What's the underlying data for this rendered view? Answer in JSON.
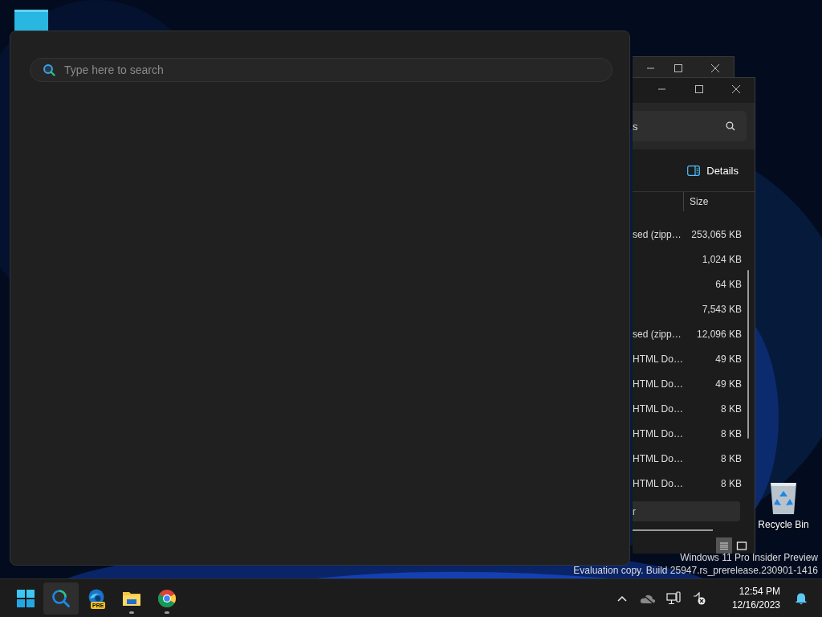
{
  "desktop_icons": [
    {
      "kind": "app"
    },
    {
      "kind": "recycle_bin",
      "label": "Recycle Bin"
    }
  ],
  "explorer_back_window": {
    "controls": [
      {
        "kind": "minimize"
      },
      {
        "kind": "maximize"
      },
      {
        "kind": "close"
      }
    ]
  },
  "explorer_window": {
    "controls": [
      {
        "kind": "minimize"
      },
      {
        "kind": "maximize"
      },
      {
        "kind": "close"
      }
    ],
    "search": {
      "value": "s"
    },
    "toolbar": {
      "details_label": "Details"
    },
    "size_header": "Size",
    "rows": [
      {
        "column_1": "sed (zipp…",
        "size": "253,065 KB"
      },
      {
        "size": "1,024 KB"
      },
      {
        "size": "64 KB"
      },
      {
        "size": "7,543 KB"
      },
      {
        "column_1": "sed (zipp…",
        "size": "12,096 KB"
      },
      {
        "column_1": "HTML Do…",
        "size": "49 KB"
      },
      {
        "column_1": "HTML Do…",
        "size": "49 KB"
      },
      {
        "column_1": "HTML Do…",
        "size": "8 KB"
      },
      {
        "column_1": "HTML Do…",
        "size": "8 KB"
      },
      {
        "column_1": "HTML Do…",
        "size": "8 KB"
      },
      {
        "column_1": "HTML Do…",
        "size": "8 KB"
      }
    ],
    "highlighted_item": {
      "text": "r"
    },
    "view_buttons": [
      {
        "kind": "details",
        "selected": true
      },
      {
        "kind": "tiles",
        "selected": false
      }
    ]
  },
  "search_panel": {
    "search": {
      "placeholder": "Type here to search"
    }
  },
  "system_notice": [
    "Windows 11 Pro Insider Preview",
    "Evaluation copy. Build 25947.rs_prerelease.230901-1416"
  ],
  "taskbar": {
    "apps": [
      {
        "kind": "start",
        "selected": false,
        "running": false
      },
      {
        "kind": "search",
        "selected": true,
        "running": false
      },
      {
        "kind": "edge",
        "badge": "PRE",
        "selected": false,
        "running": false
      },
      {
        "kind": "explorer",
        "selected": false,
        "running": true
      },
      {
        "kind": "chrome",
        "selected": false,
        "running": true
      }
    ],
    "tray": [
      {
        "kind": "chevron"
      },
      {
        "kind": "onedrive"
      },
      {
        "kind": "network"
      },
      {
        "kind": "volume"
      }
    ],
    "time": "12:54 PM",
    "date": "12/16/2023",
    "notifications": {
      "kind": "bell"
    }
  }
}
